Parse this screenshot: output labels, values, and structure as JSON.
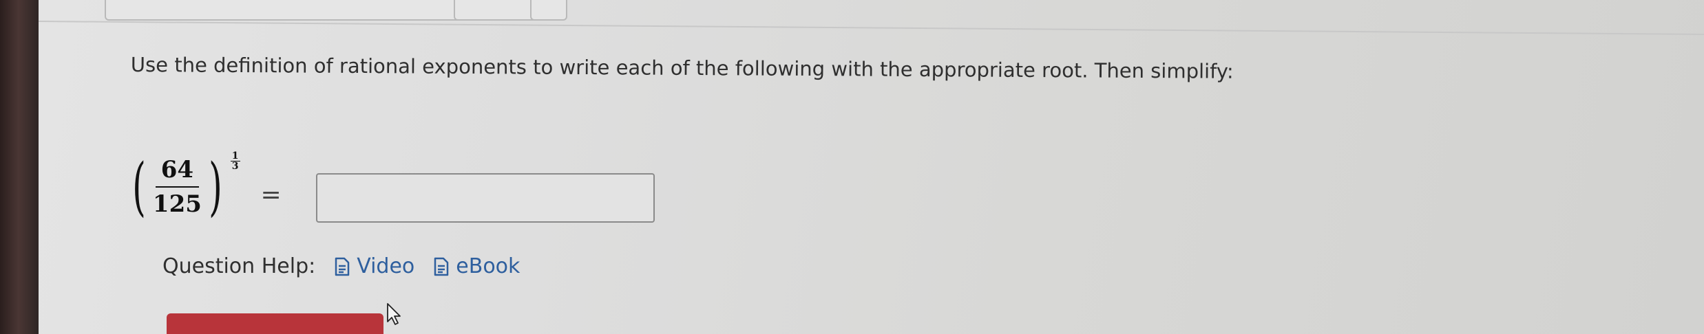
{
  "question": {
    "instruction": "Use the definition of rational exponents to write each of the following with the appropriate root. Then simplify:",
    "expression": {
      "base_numerator": "64",
      "base_denominator": "125",
      "exponent_numerator": "1",
      "exponent_denominator": "3",
      "equals": "="
    },
    "answer": {
      "value": "",
      "placeholder": ""
    }
  },
  "help": {
    "label": "Question Help:",
    "links": [
      {
        "label": "Video",
        "icon": "document-icon"
      },
      {
        "label": "eBook",
        "icon": "document-icon"
      }
    ]
  },
  "colors": {
    "link": "#2e5f9e",
    "submit": "#b8343a",
    "text": "#2f2f2f"
  }
}
